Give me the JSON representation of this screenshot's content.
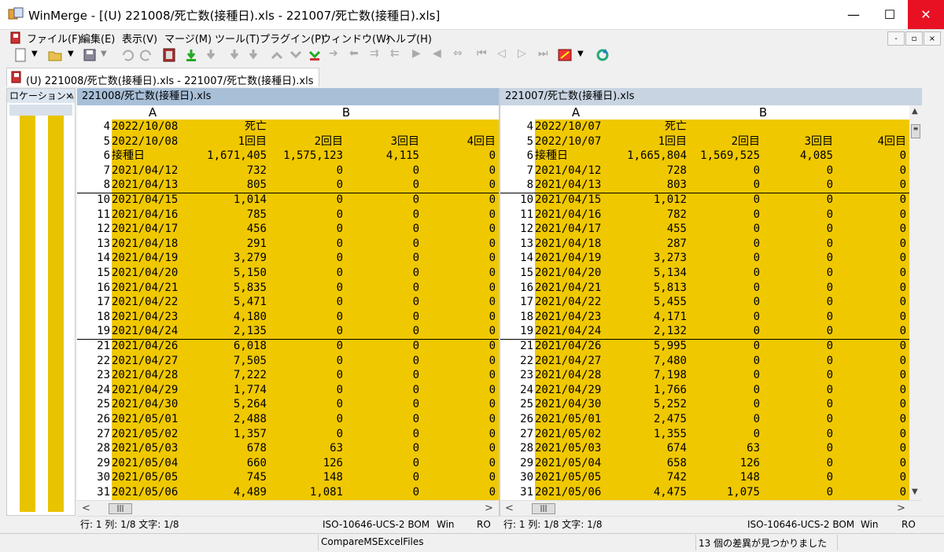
{
  "window": {
    "title": "WinMerge - [(U) 221008/死亡数(接種日).xls - 221007/死亡数(接種日).xls]",
    "min_icon": "minimize-icon",
    "max_icon": "maximize-icon",
    "close_icon": "close-icon"
  },
  "menu": [
    "ファイル(F)",
    "編集(E)",
    "表示(V)",
    "マージ(M)",
    "ツール(T)",
    "プラグイン(P)",
    "ウィンドウ(W)",
    "ヘルプ(H)"
  ],
  "mdi": {
    "min": "-",
    "restore": "▫",
    "close": "×"
  },
  "tab": {
    "label": "(U) 221008/死亡数(接種日).xls - 221007/死亡数(接種日).xls"
  },
  "location_pane": {
    "title": "ロケーション ﾍ",
    "close": "×"
  },
  "left": {
    "header": "221008/死亡数(接種日).xls",
    "col_a": "A",
    "col_b": "B",
    "rows": [
      {
        "n": "4",
        "a": "2022/10/08",
        "b1": "死亡",
        "b2": "",
        "b3": "",
        "b4": ""
      },
      {
        "n": "5",
        "a": "2022/10/08",
        "b1": "1回目",
        "b2": "2回目",
        "b3": "3回目",
        "b4": "4回目"
      },
      {
        "n": "6",
        "a": "接種日",
        "b1": "1,671,405",
        "b2": "1,575,123",
        "b3": "4,115",
        "b4": "0"
      },
      {
        "n": "7",
        "a": "2021/04/12",
        "b1": "732",
        "b2": "0",
        "b3": "0",
        "b4": "0"
      },
      {
        "n": "8",
        "a": "2021/04/13",
        "b1": "805",
        "b2": "0",
        "b3": "0",
        "b4": "0"
      },
      {
        "n": "10",
        "a": "2021/04/15",
        "b1": "1,014",
        "b2": "0",
        "b3": "0",
        "b4": "0"
      },
      {
        "n": "11",
        "a": "2021/04/16",
        "b1": "785",
        "b2": "0",
        "b3": "0",
        "b4": "0"
      },
      {
        "n": "12",
        "a": "2021/04/17",
        "b1": "456",
        "b2": "0",
        "b3": "0",
        "b4": "0"
      },
      {
        "n": "13",
        "a": "2021/04/18",
        "b1": "291",
        "b2": "0",
        "b3": "0",
        "b4": "0"
      },
      {
        "n": "14",
        "a": "2021/04/19",
        "b1": "3,279",
        "b2": "0",
        "b3": "0",
        "b4": "0"
      },
      {
        "n": "15",
        "a": "2021/04/20",
        "b1": "5,150",
        "b2": "0",
        "b3": "0",
        "b4": "0"
      },
      {
        "n": "16",
        "a": "2021/04/21",
        "b1": "5,835",
        "b2": "0",
        "b3": "0",
        "b4": "0"
      },
      {
        "n": "17",
        "a": "2021/04/22",
        "b1": "5,471",
        "b2": "0",
        "b3": "0",
        "b4": "0"
      },
      {
        "n": "18",
        "a": "2021/04/23",
        "b1": "4,180",
        "b2": "0",
        "b3": "0",
        "b4": "0"
      },
      {
        "n": "19",
        "a": "2021/04/24",
        "b1": "2,135",
        "b2": "0",
        "b3": "0",
        "b4": "0"
      },
      {
        "n": "21",
        "a": "2021/04/26",
        "b1": "6,018",
        "b2": "0",
        "b3": "0",
        "b4": "0"
      },
      {
        "n": "22",
        "a": "2021/04/27",
        "b1": "7,505",
        "b2": "0",
        "b3": "0",
        "b4": "0"
      },
      {
        "n": "23",
        "a": "2021/04/28",
        "b1": "7,222",
        "b2": "0",
        "b3": "0",
        "b4": "0"
      },
      {
        "n": "24",
        "a": "2021/04/29",
        "b1": "1,774",
        "b2": "0",
        "b3": "0",
        "b4": "0"
      },
      {
        "n": "25",
        "a": "2021/04/30",
        "b1": "5,264",
        "b2": "0",
        "b3": "0",
        "b4": "0"
      },
      {
        "n": "26",
        "a": "2021/05/01",
        "b1": "2,488",
        "b2": "0",
        "b3": "0",
        "b4": "0"
      },
      {
        "n": "27",
        "a": "2021/05/02",
        "b1": "1,357",
        "b2": "0",
        "b3": "0",
        "b4": "0"
      },
      {
        "n": "28",
        "a": "2021/05/03",
        "b1": "678",
        "b2": "63",
        "b3": "0",
        "b4": "0"
      },
      {
        "n": "29",
        "a": "2021/05/04",
        "b1": "660",
        "b2": "126",
        "b3": "0",
        "b4": "0"
      },
      {
        "n": "30",
        "a": "2021/05/05",
        "b1": "745",
        "b2": "148",
        "b3": "0",
        "b4": "0"
      },
      {
        "n": "31",
        "a": "2021/05/06",
        "b1": "4,489",
        "b2": "1,081",
        "b3": "0",
        "b4": "0"
      }
    ],
    "status": {
      "pos": "行: 1  列: 1/8  文字: 1/8",
      "enc": "ISO-10646-UCS-2 BOM",
      "eol": "Win",
      "ro": "RO"
    }
  },
  "right": {
    "header": "221007/死亡数(接種日).xls",
    "col_a": "A",
    "col_b": "B",
    "rows": [
      {
        "n": "4",
        "a": "2022/10/07",
        "b1": "死亡",
        "b2": "",
        "b3": "",
        "b4": ""
      },
      {
        "n": "5",
        "a": "2022/10/07",
        "b1": "1回目",
        "b2": "2回目",
        "b3": "3回目",
        "b4": "4回目"
      },
      {
        "n": "6",
        "a": "接種日",
        "b1": "1,665,804",
        "b2": "1,569,525",
        "b3": "4,085",
        "b4": "0"
      },
      {
        "n": "7",
        "a": "2021/04/12",
        "b1": "728",
        "b2": "0",
        "b3": "0",
        "b4": "0"
      },
      {
        "n": "8",
        "a": "2021/04/13",
        "b1": "803",
        "b2": "0",
        "b3": "0",
        "b4": "0"
      },
      {
        "n": "10",
        "a": "2021/04/15",
        "b1": "1,012",
        "b2": "0",
        "b3": "0",
        "b4": "0"
      },
      {
        "n": "11",
        "a": "2021/04/16",
        "b1": "782",
        "b2": "0",
        "b3": "0",
        "b4": "0"
      },
      {
        "n": "12",
        "a": "2021/04/17",
        "b1": "455",
        "b2": "0",
        "b3": "0",
        "b4": "0"
      },
      {
        "n": "13",
        "a": "2021/04/18",
        "b1": "287",
        "b2": "0",
        "b3": "0",
        "b4": "0"
      },
      {
        "n": "14",
        "a": "2021/04/19",
        "b1": "3,273",
        "b2": "0",
        "b3": "0",
        "b4": "0"
      },
      {
        "n": "15",
        "a": "2021/04/20",
        "b1": "5,134",
        "b2": "0",
        "b3": "0",
        "b4": "0"
      },
      {
        "n": "16",
        "a": "2021/04/21",
        "b1": "5,813",
        "b2": "0",
        "b3": "0",
        "b4": "0"
      },
      {
        "n": "17",
        "a": "2021/04/22",
        "b1": "5,455",
        "b2": "0",
        "b3": "0",
        "b4": "0"
      },
      {
        "n": "18",
        "a": "2021/04/23",
        "b1": "4,171",
        "b2": "0",
        "b3": "0",
        "b4": "0"
      },
      {
        "n": "19",
        "a": "2021/04/24",
        "b1": "2,132",
        "b2": "0",
        "b3": "0",
        "b4": "0"
      },
      {
        "n": "21",
        "a": "2021/04/26",
        "b1": "5,995",
        "b2": "0",
        "b3": "0",
        "b4": "0"
      },
      {
        "n": "22",
        "a": "2021/04/27",
        "b1": "7,480",
        "b2": "0",
        "b3": "0",
        "b4": "0"
      },
      {
        "n": "23",
        "a": "2021/04/28",
        "b1": "7,198",
        "b2": "0",
        "b3": "0",
        "b4": "0"
      },
      {
        "n": "24",
        "a": "2021/04/29",
        "b1": "1,766",
        "b2": "0",
        "b3": "0",
        "b4": "0"
      },
      {
        "n": "25",
        "a": "2021/04/30",
        "b1": "5,252",
        "b2": "0",
        "b3": "0",
        "b4": "0"
      },
      {
        "n": "26",
        "a": "2021/05/01",
        "b1": "2,475",
        "b2": "0",
        "b3": "0",
        "b4": "0"
      },
      {
        "n": "27",
        "a": "2021/05/02",
        "b1": "1,355",
        "b2": "0",
        "b3": "0",
        "b4": "0"
      },
      {
        "n": "28",
        "a": "2021/05/03",
        "b1": "674",
        "b2": "63",
        "b3": "0",
        "b4": "0"
      },
      {
        "n": "29",
        "a": "2021/05/04",
        "b1": "658",
        "b2": "126",
        "b3": "0",
        "b4": "0"
      },
      {
        "n": "30",
        "a": "2021/05/05",
        "b1": "742",
        "b2": "148",
        "b3": "0",
        "b4": "0"
      },
      {
        "n": "31",
        "a": "2021/05/06",
        "b1": "4,475",
        "b2": "1,075",
        "b3": "0",
        "b4": "0"
      }
    ],
    "status": {
      "pos": "行: 1  列: 1/8  文字: 1/8",
      "enc": "ISO-10646-UCS-2 BOM",
      "eol": "Win",
      "ro": "RO"
    }
  },
  "statusbar": {
    "plugin": "CompareMSExcelFiles",
    "diffs": "13 個の差異が見つかりました"
  },
  "colors": {
    "diff": "#f0c800",
    "diff_word": "#f5e9c0",
    "pane_header": "#a8bfd8",
    "close": "#e81123"
  },
  "toolbar_icons": [
    "new-icon",
    "open-icon",
    "save-icon",
    "undo-icon",
    "redo-icon",
    "filmstrip-icon",
    "copy-right-icon",
    "copy-left-icon",
    "first-diff-icon",
    "prev-diff-icon",
    "next-diff-icon",
    "last-diff-icon",
    "merge-icon",
    "refresh-icon"
  ]
}
